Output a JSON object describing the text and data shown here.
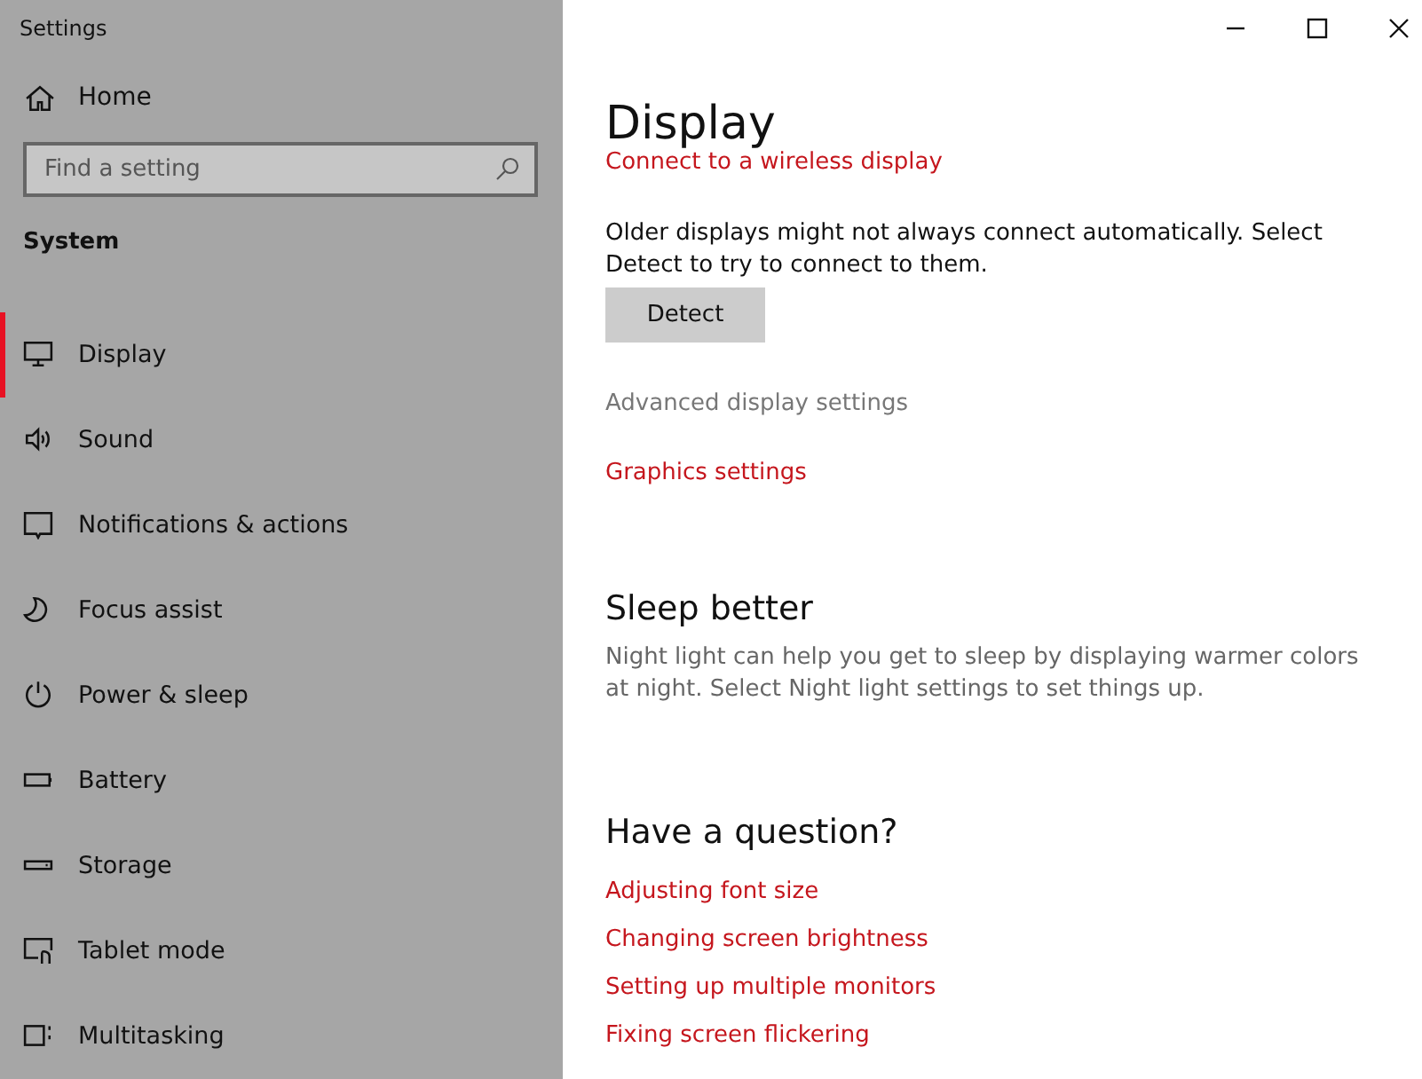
{
  "window": {
    "title": "Settings",
    "controls": [
      {
        "kind": "minimize"
      },
      {
        "kind": "maximize"
      },
      {
        "kind": "close"
      }
    ]
  },
  "sidebar": {
    "home": {
      "label": "Home"
    },
    "search": {
      "placeholder": "Find a setting"
    },
    "section": "System",
    "items": [
      {
        "label": "Display",
        "kind": "display",
        "selected": true
      },
      {
        "label": "Sound",
        "kind": "sound",
        "selected": false
      },
      {
        "label": "Notifications & actions",
        "kind": "notifications",
        "selected": false
      },
      {
        "label": "Focus assist",
        "kind": "moon",
        "selected": false
      },
      {
        "label": "Power & sleep",
        "kind": "power",
        "selected": false
      },
      {
        "label": "Battery",
        "kind": "battery",
        "selected": false
      },
      {
        "label": "Storage",
        "kind": "storage",
        "selected": false
      },
      {
        "label": "Tablet mode",
        "kind": "tablet",
        "selected": false
      },
      {
        "label": "Multitasking",
        "kind": "multitasking",
        "selected": false
      }
    ]
  },
  "page": {
    "title": "Display",
    "blocks": [
      {
        "kind": "link",
        "text": "Connect to a wireless display",
        "hovered": false
      },
      {
        "kind": "paragraph",
        "text": "Older displays might not always connect automatically. Select Detect to try to connect to them."
      },
      {
        "kind": "button",
        "text": "Detect"
      },
      {
        "kind": "link",
        "text": "Advanced display settings",
        "hovered": true
      },
      {
        "kind": "link",
        "text": "Graphics settings",
        "hovered": false
      },
      {
        "kind": "heading",
        "text": "Sleep better"
      },
      {
        "kind": "note",
        "text": "Night light can help you get to sleep by displaying warmer colors at night. Select Night light settings to set things up."
      },
      {
        "kind": "heading",
        "text": "Have a question?"
      },
      {
        "kind": "link",
        "text": "Adjusting font size",
        "hovered": false
      },
      {
        "kind": "link",
        "text": "Changing screen brightness",
        "hovered": false
      },
      {
        "kind": "link",
        "text": "Setting up multiple monitors",
        "hovered": false
      },
      {
        "kind": "link",
        "text": "Fixing screen flickering",
        "hovered": false
      }
    ]
  }
}
